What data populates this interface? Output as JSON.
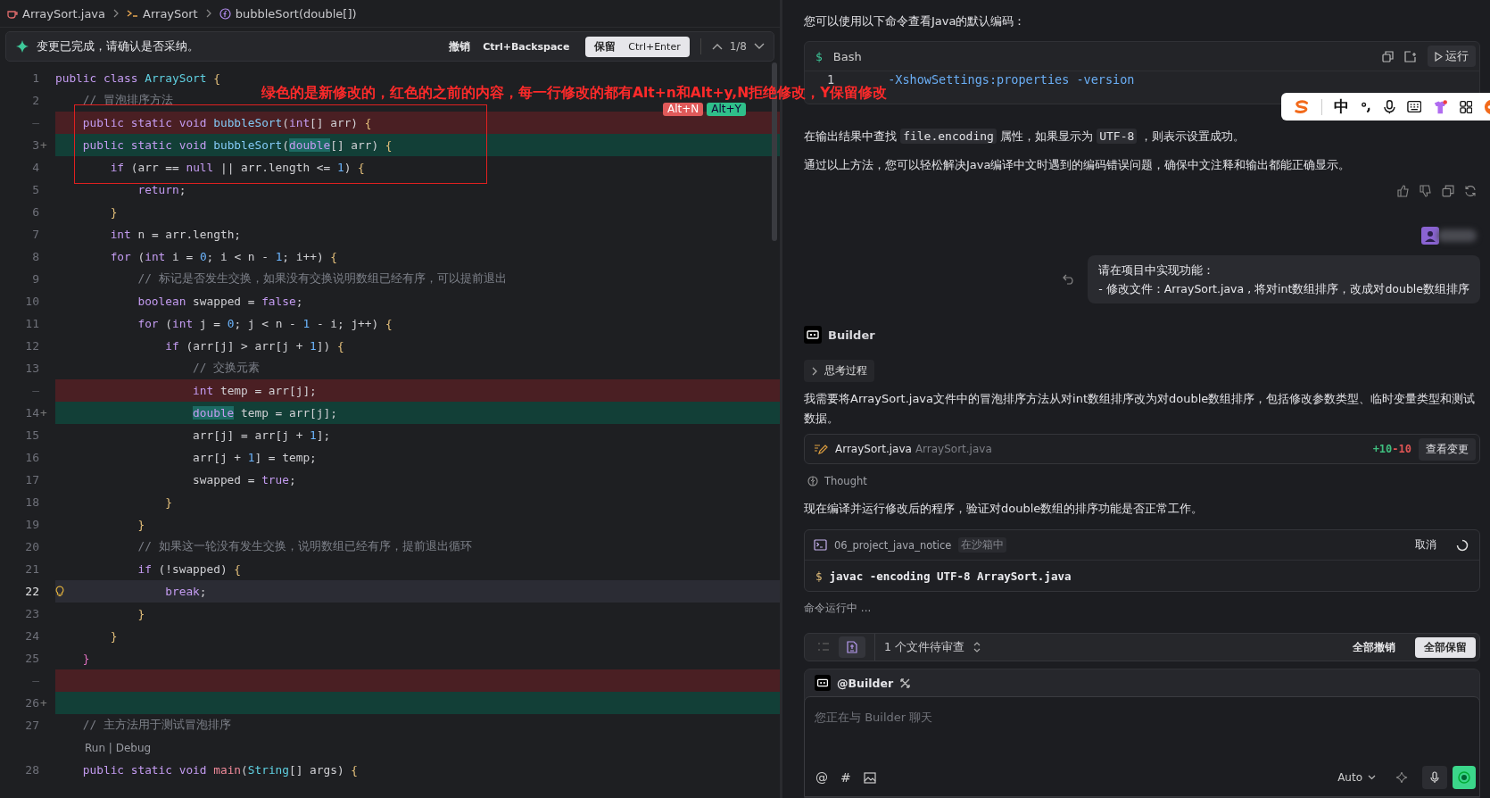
{
  "editor": {
    "breadcrumb": [
      {
        "kind": "file",
        "label": "ArraySort.java"
      },
      {
        "kind": "class",
        "label": "ArraySort"
      },
      {
        "kind": "method",
        "label": "bubbleSort(double[])"
      }
    ],
    "diff_bar": {
      "message": "变更已完成，请确认是否采纳。",
      "reject": {
        "label": "撤销",
        "shortcut": "Ctrl+Backspace"
      },
      "accept": {
        "label": "保留",
        "shortcut": "Ctrl+Enter"
      },
      "position": "1/8"
    },
    "lines": [
      {
        "kind": "normal",
        "num": "1",
        "tokens": [
          {
            "kind": "kw",
            "t": "public class "
          },
          {
            "kind": "type",
            "t": "ArraySort"
          },
          {
            "kind": "brace",
            "t": " {"
          }
        ]
      },
      {
        "kind": "normal",
        "num": "2",
        "tokens": [
          {
            "kind": "c",
            "t": "    // 冒泡排序方法"
          }
        ]
      },
      {
        "kind": "deleted",
        "num": "–",
        "tokens": [
          {
            "kind": "kw",
            "t": "    public static void "
          },
          {
            "kind": "fn",
            "t": "bubbleSort"
          },
          {
            "kind": "p",
            "t": "("
          },
          {
            "kind": "kw",
            "t": "int"
          },
          {
            "kind": "p",
            "t": "[] arr) "
          },
          {
            "kind": "brace",
            "t": "{"
          }
        ]
      },
      {
        "kind": "added",
        "num": "3",
        "mark": "+",
        "tokens": [
          {
            "kind": "kw",
            "t": "    public static void "
          },
          {
            "kind": "fn",
            "t": "bubbleSort"
          },
          {
            "kind": "p",
            "t": "("
          },
          {
            "kind": "hl",
            "t": "double"
          },
          {
            "kind": "p",
            "t": "[] arr) "
          },
          {
            "kind": "brace",
            "t": "{"
          }
        ]
      },
      {
        "kind": "normal",
        "num": "4",
        "tokens": [
          {
            "kind": "kw",
            "t": "        if"
          },
          {
            "kind": "p",
            "t": " (arr == "
          },
          {
            "kind": "kw",
            "t": "null"
          },
          {
            "kind": "p",
            "t": " || arr.length <= "
          },
          {
            "kind": "num",
            "t": "1"
          },
          {
            "kind": "p",
            "t": ") "
          },
          {
            "kind": "brace",
            "t": "{"
          }
        ]
      },
      {
        "kind": "normal",
        "num": "5",
        "tokens": [
          {
            "kind": "kw",
            "t": "            return"
          },
          {
            "kind": "p",
            "t": ";"
          }
        ]
      },
      {
        "kind": "normal",
        "num": "6",
        "tokens": [
          {
            "kind": "brace",
            "t": "        }"
          }
        ]
      },
      {
        "kind": "normal",
        "num": "7",
        "tokens": [
          {
            "kind": "kw",
            "t": "        int"
          },
          {
            "kind": "p",
            "t": " n = arr.length;"
          }
        ]
      },
      {
        "kind": "normal",
        "num": "8",
        "tokens": [
          {
            "kind": "kw",
            "t": "        for"
          },
          {
            "kind": "p",
            "t": " ("
          },
          {
            "kind": "kw",
            "t": "int"
          },
          {
            "kind": "p",
            "t": " i = "
          },
          {
            "kind": "num",
            "t": "0"
          },
          {
            "kind": "p",
            "t": "; i < n - "
          },
          {
            "kind": "num",
            "t": "1"
          },
          {
            "kind": "p",
            "t": "; i++) "
          },
          {
            "kind": "brace",
            "t": "{"
          }
        ]
      },
      {
        "kind": "normal",
        "num": "9",
        "tokens": [
          {
            "kind": "c",
            "t": "            // 标记是否发生交换，如果没有交换说明数组已经有序，可以提前退出"
          }
        ]
      },
      {
        "kind": "normal",
        "num": "10",
        "tokens": [
          {
            "kind": "kw",
            "t": "            boolean"
          },
          {
            "kind": "p",
            "t": " swapped = "
          },
          {
            "kind": "kw",
            "t": "false"
          },
          {
            "kind": "p",
            "t": ";"
          }
        ]
      },
      {
        "kind": "normal",
        "num": "11",
        "tokens": [
          {
            "kind": "kw",
            "t": "            for"
          },
          {
            "kind": "p",
            "t": " ("
          },
          {
            "kind": "kw",
            "t": "int"
          },
          {
            "kind": "p",
            "t": " j = "
          },
          {
            "kind": "num",
            "t": "0"
          },
          {
            "kind": "p",
            "t": "; j < n - "
          },
          {
            "kind": "num",
            "t": "1"
          },
          {
            "kind": "p",
            "t": " - i; j++) "
          },
          {
            "kind": "brace",
            "t": "{"
          }
        ]
      },
      {
        "kind": "normal",
        "num": "12",
        "tokens": [
          {
            "kind": "kw",
            "t": "                if"
          },
          {
            "kind": "p",
            "t": " (arr[j] > arr[j + "
          },
          {
            "kind": "num",
            "t": "1"
          },
          {
            "kind": "p",
            "t": "]) "
          },
          {
            "kind": "brace",
            "t": "{"
          }
        ]
      },
      {
        "kind": "normal",
        "num": "13",
        "tokens": [
          {
            "kind": "c",
            "t": "                    // 交换元素"
          }
        ]
      },
      {
        "kind": "deleted",
        "num": "–",
        "tokens": [
          {
            "kind": "kw",
            "t": "                    int"
          },
          {
            "kind": "p",
            "t": " temp = arr[j];"
          }
        ]
      },
      {
        "kind": "added",
        "num": "14",
        "mark": "+",
        "tokens": [
          {
            "kind": "hl",
            "t": "                    double"
          },
          {
            "kind": "p",
            "t": " temp = arr[j];"
          }
        ]
      },
      {
        "kind": "normal",
        "num": "15",
        "tokens": [
          {
            "kind": "p",
            "t": "                    arr[j] = arr[j + "
          },
          {
            "kind": "num",
            "t": "1"
          },
          {
            "kind": "p",
            "t": "];"
          }
        ]
      },
      {
        "kind": "normal",
        "num": "16",
        "tokens": [
          {
            "kind": "p",
            "t": "                    arr[j + "
          },
          {
            "kind": "num",
            "t": "1"
          },
          {
            "kind": "p",
            "t": "] = temp;"
          }
        ]
      },
      {
        "kind": "normal",
        "num": "17",
        "tokens": [
          {
            "kind": "p",
            "t": "                    swapped = "
          },
          {
            "kind": "kw",
            "t": "true"
          },
          {
            "kind": "p",
            "t": ";"
          }
        ]
      },
      {
        "kind": "normal",
        "num": "18",
        "tokens": [
          {
            "kind": "brace",
            "t": "                }"
          }
        ]
      },
      {
        "kind": "normal",
        "num": "19",
        "tokens": [
          {
            "kind": "brace",
            "t": "            }"
          }
        ]
      },
      {
        "kind": "normal",
        "num": "20",
        "tokens": [
          {
            "kind": "c",
            "t": "            // 如果这一轮没有发生交换，说明数组已经有序，提前退出循环"
          }
        ]
      },
      {
        "kind": "normal",
        "num": "21",
        "tokens": [
          {
            "kind": "kw",
            "t": "            if"
          },
          {
            "kind": "p",
            "t": " (!swapped) "
          },
          {
            "kind": "brace",
            "t": "{"
          }
        ]
      },
      {
        "kind": "current",
        "num": "22",
        "tokens": [
          {
            "kind": "kw",
            "t": "                break"
          },
          {
            "kind": "p",
            "t": ";"
          }
        ]
      },
      {
        "kind": "normal",
        "num": "23",
        "tokens": [
          {
            "kind": "brace",
            "t": "            }"
          }
        ]
      },
      {
        "kind": "normal",
        "num": "24",
        "tokens": [
          {
            "kind": "brace",
            "t": "        }"
          }
        ]
      },
      {
        "kind": "normal",
        "num": "25",
        "tokens": [
          {
            "kind": "brace2",
            "t": "    }"
          }
        ]
      },
      {
        "kind": "deleted",
        "num": "–"
      },
      {
        "kind": "added",
        "num": "26",
        "mark": "+"
      },
      {
        "kind": "normal",
        "num": "27",
        "tokens": [
          {
            "kind": "c",
            "t": "    // 主方法用于测试冒泡排序"
          }
        ]
      },
      {
        "kind": "lens",
        "text": "Run | Debug"
      },
      {
        "kind": "normal",
        "num": "28",
        "tokens": [
          {
            "kind": "kw",
            "t": "    public static void "
          },
          {
            "kind": "fn2",
            "t": "main"
          },
          {
            "kind": "p",
            "t": "("
          },
          {
            "kind": "type",
            "t": "String"
          },
          {
            "kind": "p",
            "t": "[] args) "
          },
          {
            "kind": "brace",
            "t": "{"
          }
        ]
      }
    ],
    "inline_actions": [
      {
        "kind": "reject",
        "label": "Alt+N"
      },
      {
        "kind": "accept",
        "label": "Alt+Y"
      }
    ]
  },
  "annotation": "绿色的是新修改的，红色的之前的内容，每一行修改的都有Alt+n和Alt+y,N拒绝修改，Y保留修改",
  "ime_toolbar": {
    "label": "中"
  },
  "chat": {
    "intro": "您可以使用以下命令查看Java的默认编码：",
    "code_block": {
      "prompt": "$",
      "language": "Bash",
      "run_label": "运行",
      "line_number": "1",
      "code": "-XshowSettings:properties -version"
    },
    "paragraphs": [
      {
        "parts": [
          {
            "kind": "text",
            "text": "在输出结果中查找 "
          },
          {
            "kind": "code",
            "text": "file.encoding"
          },
          {
            "kind": "text",
            "text": " 属性，如果显示为 "
          },
          {
            "kind": "code",
            "text": "UTF-8"
          },
          {
            "kind": "text",
            "text": " ，则表示设置成功。"
          }
        ]
      },
      {
        "parts": [
          {
            "kind": "text",
            "text": "通过以上方法，您可以轻松解决Java编译中文时遇到的编码错误问题，确保中文注释和输出都能正确显示。"
          }
        ]
      }
    ],
    "user_message": [
      "请在项目中实现功能：",
      "- 修改文件：ArraySort.java , 将对int数组排序，改成对double数组排序"
    ],
    "agent": {
      "name": "Builder",
      "thinking_label": "思考过程",
      "thinking_expanded": false,
      "message": "我需要将ArraySort.java文件中的冒泡排序方法从对int数组排序改为对double数组排序，包括修改参数类型、临时变量类型和测试数据。",
      "file_change": {
        "name": "ArraySort.java",
        "path": "ArraySort.java",
        "added": "+10",
        "removed": "-10",
        "button": "查看变更"
      },
      "thought_label": "Thought",
      "message_2": "现在编译并运行修改后的程序，验证对double数组的排序功能是否正常工作。",
      "terminal": {
        "project": "06_project_java_notice",
        "badge": "在沙箱中",
        "cancel": "取消",
        "prompt": "$",
        "command": "javac -encoding UTF-8 ArraySort.java"
      },
      "status": "命令运行中 ..."
    }
  },
  "review_bar": {
    "summary": "1 个文件待审查",
    "reject_all": "全部撤销",
    "accept_all": "全部保留"
  },
  "composer": {
    "mention": "@Builder",
    "placeholder": "您正在与 Builder 聊天",
    "tools": [
      "@",
      "#"
    ],
    "model": "Auto"
  }
}
